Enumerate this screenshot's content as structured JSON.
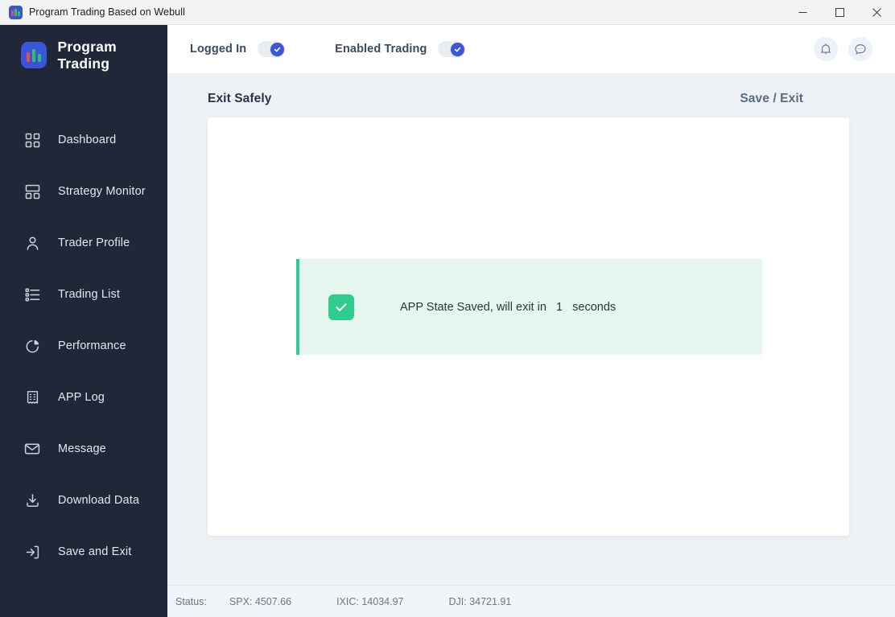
{
  "window": {
    "title": "Program Trading Based on Webull",
    "controls": {
      "minimize": "minimize-icon",
      "maximize": "maximize-icon",
      "close": "close-icon"
    }
  },
  "sidebar": {
    "brand": "Program Trading",
    "brand_icon": "bar-chart-logo-icon",
    "items": [
      {
        "label": "Dashboard",
        "icon": "grid-icon"
      },
      {
        "label": "Strategy Monitor",
        "icon": "layout-icon"
      },
      {
        "label": "Trader Profile",
        "icon": "user-icon"
      },
      {
        "label": "Trading List",
        "icon": "list-icon"
      },
      {
        "label": "Performance",
        "icon": "pie-chart-icon"
      },
      {
        "label": "APP Log",
        "icon": "receipt-icon"
      },
      {
        "label": "Message",
        "icon": "envelope-icon"
      },
      {
        "label": "Download Data",
        "icon": "download-icon"
      },
      {
        "label": "Save and Exit",
        "icon": "logout-icon"
      }
    ],
    "active_item": "Save and Exit"
  },
  "topbar": {
    "toggles": [
      {
        "label": "Logged In",
        "state": "on",
        "icon": "check-icon"
      },
      {
        "label": "Enabled Trading",
        "state": "on",
        "icon": "check-icon"
      }
    ],
    "actions": [
      {
        "name": "notifications",
        "icon": "bell-icon"
      },
      {
        "name": "messages",
        "icon": "chat-bubble-icon"
      }
    ]
  },
  "content": {
    "page_title": "Exit Safely",
    "head_action": "Save / Exit",
    "alert": {
      "icon": "check-square-icon",
      "text_before": "APP State Saved, will exit in",
      "countdown": "1",
      "text_after": "seconds"
    }
  },
  "statusbar": {
    "label": "Status:",
    "quotes": [
      "SPX: 4507.66",
      "IXIC: 14034.97",
      "DJI: 34721.91"
    ]
  },
  "colors": {
    "sidebar_bg": "#1f2739",
    "accent_blue": "#3b55d9",
    "success_green": "#2ecc8f",
    "alert_bg": "#e6f7ef",
    "app_bg": "#eef1f6"
  }
}
